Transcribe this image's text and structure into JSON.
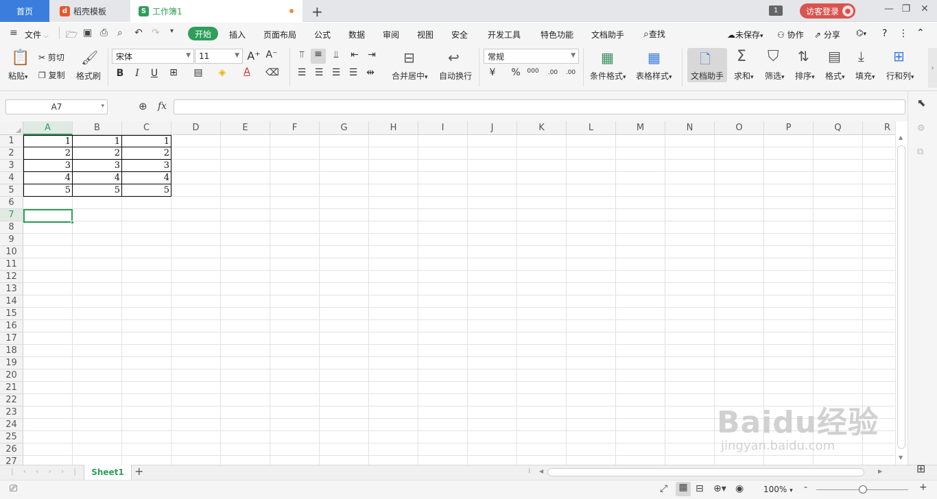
{
  "tabs": {
    "home": "首页",
    "template": "稻壳模板",
    "workbook": "工作簿1",
    "new_tab": "+",
    "window_count": "1",
    "login": "访客登录"
  },
  "menu": {
    "file": "文件",
    "items": [
      "开始",
      "插入",
      "页面布局",
      "公式",
      "数据",
      "审阅",
      "视图",
      "安全",
      "开发工具",
      "特色功能",
      "文档助手"
    ],
    "search": "查找",
    "unsaved": "未保存",
    "collab": "协作",
    "share": "分享",
    "help": "?"
  },
  "ribbon": {
    "paste": "粘贴",
    "cut": "剪切",
    "copy": "复制",
    "format_painter": "格式刷",
    "font_name": "宋体",
    "font_size": "11",
    "bold": "B",
    "italic": "I",
    "underline": "U",
    "font_color_letter": "A",
    "merge_center": "合并居中",
    "wrap_text": "自动换行",
    "number_format": "常规",
    "percent": "%",
    "thousands": "000",
    "inc_decimal": ".00",
    "dec_decimal": ".00",
    "conditional_format": "条件格式",
    "table_style": "表格样式",
    "doc_helper": "文档助手",
    "sum": "求和",
    "filter": "筛选",
    "sort": "排序",
    "format": "格式",
    "fill": "填充",
    "row_col": "行和列"
  },
  "formula_bar": {
    "name_box": "A7",
    "fx": "fx",
    "value": ""
  },
  "grid": {
    "columns": [
      "A",
      "B",
      "C",
      "D",
      "E",
      "F",
      "G",
      "H",
      "I",
      "J",
      "K",
      "L",
      "M",
      "N",
      "O",
      "P",
      "Q",
      "R"
    ],
    "rows": [
      "1",
      "2",
      "3",
      "4",
      "5",
      "6",
      "7",
      "8",
      "9",
      "10",
      "11",
      "12",
      "13",
      "14",
      "15",
      "16",
      "17",
      "18",
      "19",
      "20",
      "21",
      "22",
      "23",
      "24",
      "25",
      "26",
      "27"
    ],
    "cells": [
      [
        "1",
        "1",
        "1"
      ],
      [
        "2",
        "2",
        "2"
      ],
      [
        "3",
        "3",
        "3"
      ],
      [
        "4",
        "4",
        "4"
      ],
      [
        "5",
        "5",
        "5"
      ]
    ],
    "selected_cell": "A7"
  },
  "sheets": {
    "active": "Sheet1",
    "add": "+"
  },
  "status": {
    "zoom": "100%",
    "zoom_minus": "-",
    "zoom_plus": "+"
  },
  "watermark": {
    "brand": "Baidu经验",
    "url": "jingyan.baidu.com"
  },
  "colors": {
    "accent_green": "#2f9e5b",
    "home_tab_blue": "#3b7ddd",
    "login_red": "#d9534f"
  }
}
